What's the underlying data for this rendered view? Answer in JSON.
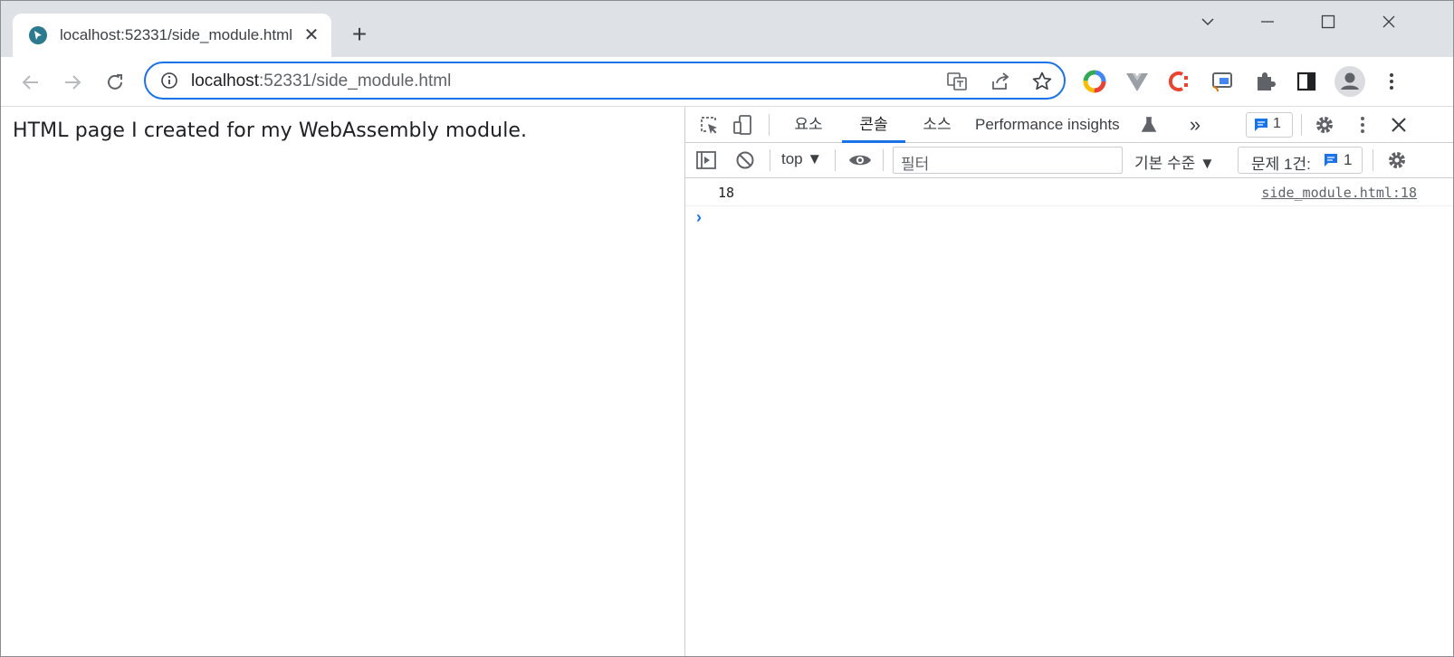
{
  "browser": {
    "tab": {
      "title": "localhost:52331/side_module.html",
      "close": "✕"
    },
    "new_tab": "+",
    "address": {
      "host": "localhost",
      "rest": ":52331/side_module.html"
    }
  },
  "page": {
    "text": "HTML page I created for my WebAssembly module."
  },
  "devtools": {
    "tabs": [
      "요소",
      "콘솔",
      "소스",
      "Performance insights"
    ],
    "active_tab": "콘솔",
    "more": "»",
    "messages_count": "1",
    "context": "top ▼",
    "filter_placeholder": "필터",
    "levels": "기본 수준 ▼",
    "issues_label": "문제 1건:",
    "issues_count": "1",
    "console": {
      "value": "18",
      "source": "side_module.html:18",
      "prompt": "›"
    }
  },
  "colors": {
    "accent": "#1a73e8",
    "tabstrip": "#dee1e6"
  }
}
